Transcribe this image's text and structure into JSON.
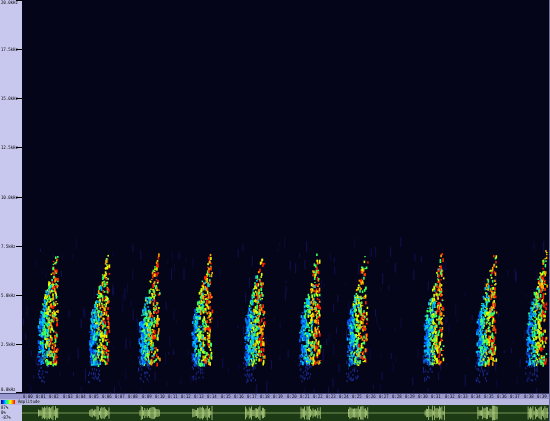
{
  "frequency_axis": {
    "labels": [
      "20.0kHz",
      "17.5kHz",
      "15.0kHz",
      "12.5kHz",
      "10.0kHz",
      "7.5kHz",
      "5.0kHz",
      "2.5kHz",
      "0.0kHz"
    ],
    "max_khz": 20.0
  },
  "time_ruler": {
    "labels": [
      "0:00",
      "0:01",
      "0:02",
      "0:03",
      "0:04",
      "0:05",
      "0:06",
      "0:07",
      "0:08",
      "0:09",
      "0:10",
      "0:11",
      "0:12",
      "0:13",
      "0:14",
      "0:15",
      "0:16",
      "0:17",
      "0:18",
      "0:19",
      "0:20",
      "0:21",
      "0:22",
      "0:23",
      "0:24",
      "0:25",
      "0:26",
      "0:27",
      "0:28",
      "0:29",
      "0:30",
      "0:31",
      "0:32",
      "0:33",
      "0:34",
      "0:35",
      "0:36",
      "0:37",
      "0:38",
      "0:39"
    ]
  },
  "colorbar": {
    "label": "Amplitude"
  },
  "waveform_axis": {
    "labels": [
      "87%",
      "0%",
      "-87%"
    ]
  },
  "calls": {
    "time_positions": [
      0.058,
      0.155,
      0.25,
      0.35,
      0.45,
      0.555,
      0.645,
      0.79,
      0.89,
      0.985
    ],
    "freq_low_khz": 1.5,
    "freq_high_khz": 7.3
  },
  "colors": {
    "background": "#05051a",
    "panel": "#c8c8ee",
    "waveform_bg": "#1c3a14",
    "waveform_trace": "#c8e890"
  }
}
